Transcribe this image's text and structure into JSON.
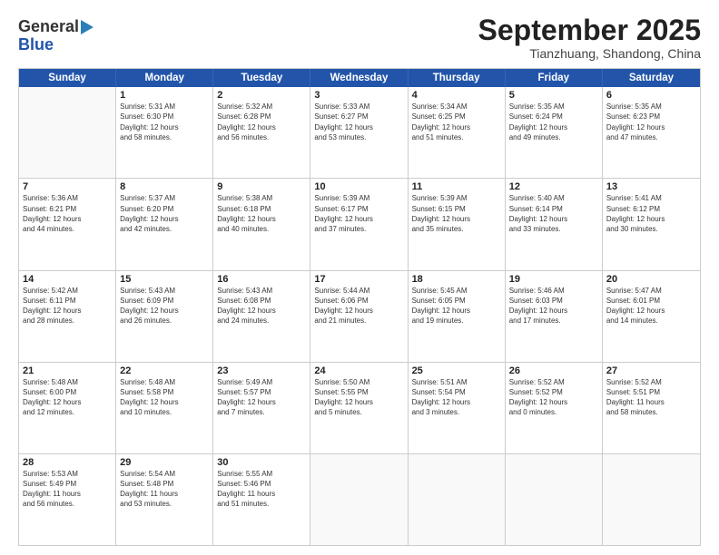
{
  "logo": {
    "general": "General",
    "blue": "Blue"
  },
  "title": "September 2025",
  "subtitle": "Tianzhuang, Shandong, China",
  "header_days": [
    "Sunday",
    "Monday",
    "Tuesday",
    "Wednesday",
    "Thursday",
    "Friday",
    "Saturday"
  ],
  "weeks": [
    [
      {
        "day": "",
        "info": ""
      },
      {
        "day": "1",
        "info": "Sunrise: 5:31 AM\nSunset: 6:30 PM\nDaylight: 12 hours\nand 58 minutes."
      },
      {
        "day": "2",
        "info": "Sunrise: 5:32 AM\nSunset: 6:28 PM\nDaylight: 12 hours\nand 56 minutes."
      },
      {
        "day": "3",
        "info": "Sunrise: 5:33 AM\nSunset: 6:27 PM\nDaylight: 12 hours\nand 53 minutes."
      },
      {
        "day": "4",
        "info": "Sunrise: 5:34 AM\nSunset: 6:25 PM\nDaylight: 12 hours\nand 51 minutes."
      },
      {
        "day": "5",
        "info": "Sunrise: 5:35 AM\nSunset: 6:24 PM\nDaylight: 12 hours\nand 49 minutes."
      },
      {
        "day": "6",
        "info": "Sunrise: 5:35 AM\nSunset: 6:23 PM\nDaylight: 12 hours\nand 47 minutes."
      }
    ],
    [
      {
        "day": "7",
        "info": "Sunrise: 5:36 AM\nSunset: 6:21 PM\nDaylight: 12 hours\nand 44 minutes."
      },
      {
        "day": "8",
        "info": "Sunrise: 5:37 AM\nSunset: 6:20 PM\nDaylight: 12 hours\nand 42 minutes."
      },
      {
        "day": "9",
        "info": "Sunrise: 5:38 AM\nSunset: 6:18 PM\nDaylight: 12 hours\nand 40 minutes."
      },
      {
        "day": "10",
        "info": "Sunrise: 5:39 AM\nSunset: 6:17 PM\nDaylight: 12 hours\nand 37 minutes."
      },
      {
        "day": "11",
        "info": "Sunrise: 5:39 AM\nSunset: 6:15 PM\nDaylight: 12 hours\nand 35 minutes."
      },
      {
        "day": "12",
        "info": "Sunrise: 5:40 AM\nSunset: 6:14 PM\nDaylight: 12 hours\nand 33 minutes."
      },
      {
        "day": "13",
        "info": "Sunrise: 5:41 AM\nSunset: 6:12 PM\nDaylight: 12 hours\nand 30 minutes."
      }
    ],
    [
      {
        "day": "14",
        "info": "Sunrise: 5:42 AM\nSunset: 6:11 PM\nDaylight: 12 hours\nand 28 minutes."
      },
      {
        "day": "15",
        "info": "Sunrise: 5:43 AM\nSunset: 6:09 PM\nDaylight: 12 hours\nand 26 minutes."
      },
      {
        "day": "16",
        "info": "Sunrise: 5:43 AM\nSunset: 6:08 PM\nDaylight: 12 hours\nand 24 minutes."
      },
      {
        "day": "17",
        "info": "Sunrise: 5:44 AM\nSunset: 6:06 PM\nDaylight: 12 hours\nand 21 minutes."
      },
      {
        "day": "18",
        "info": "Sunrise: 5:45 AM\nSunset: 6:05 PM\nDaylight: 12 hours\nand 19 minutes."
      },
      {
        "day": "19",
        "info": "Sunrise: 5:46 AM\nSunset: 6:03 PM\nDaylight: 12 hours\nand 17 minutes."
      },
      {
        "day": "20",
        "info": "Sunrise: 5:47 AM\nSunset: 6:01 PM\nDaylight: 12 hours\nand 14 minutes."
      }
    ],
    [
      {
        "day": "21",
        "info": "Sunrise: 5:48 AM\nSunset: 6:00 PM\nDaylight: 12 hours\nand 12 minutes."
      },
      {
        "day": "22",
        "info": "Sunrise: 5:48 AM\nSunset: 5:58 PM\nDaylight: 12 hours\nand 10 minutes."
      },
      {
        "day": "23",
        "info": "Sunrise: 5:49 AM\nSunset: 5:57 PM\nDaylight: 12 hours\nand 7 minutes."
      },
      {
        "day": "24",
        "info": "Sunrise: 5:50 AM\nSunset: 5:55 PM\nDaylight: 12 hours\nand 5 minutes."
      },
      {
        "day": "25",
        "info": "Sunrise: 5:51 AM\nSunset: 5:54 PM\nDaylight: 12 hours\nand 3 minutes."
      },
      {
        "day": "26",
        "info": "Sunrise: 5:52 AM\nSunset: 5:52 PM\nDaylight: 12 hours\nand 0 minutes."
      },
      {
        "day": "27",
        "info": "Sunrise: 5:52 AM\nSunset: 5:51 PM\nDaylight: 11 hours\nand 58 minutes."
      }
    ],
    [
      {
        "day": "28",
        "info": "Sunrise: 5:53 AM\nSunset: 5:49 PM\nDaylight: 11 hours\nand 56 minutes."
      },
      {
        "day": "29",
        "info": "Sunrise: 5:54 AM\nSunset: 5:48 PM\nDaylight: 11 hours\nand 53 minutes."
      },
      {
        "day": "30",
        "info": "Sunrise: 5:55 AM\nSunset: 5:46 PM\nDaylight: 11 hours\nand 51 minutes."
      },
      {
        "day": "",
        "info": ""
      },
      {
        "day": "",
        "info": ""
      },
      {
        "day": "",
        "info": ""
      },
      {
        "day": "",
        "info": ""
      }
    ]
  ]
}
